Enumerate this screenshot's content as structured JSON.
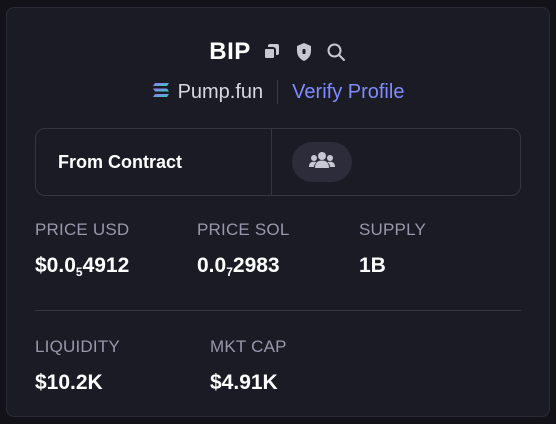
{
  "token": {
    "symbol": "BIP",
    "platform": "Pump.fun",
    "verify_label": "Verify Profile"
  },
  "contract": {
    "label": "From Contract"
  },
  "stats": {
    "price_usd": {
      "label": "PRICE USD",
      "prefix": "$0.0",
      "sub": "5",
      "suffix": "4912"
    },
    "price_sol": {
      "label": "PRICE SOL",
      "prefix": "0.0",
      "sub": "7",
      "suffix": "2983"
    },
    "supply": {
      "label": "SUPPLY",
      "value": "1B"
    },
    "liquidity": {
      "label": "LIQUIDITY",
      "value": "$10.2K"
    },
    "mkt_cap": {
      "label": "MKT CAP",
      "value": "$4.91K"
    }
  },
  "icons": {
    "copy": "copy-icon",
    "shield": "shield-icon",
    "search": "search-icon",
    "platform": "pumpfun-logo-icon",
    "holders": "users-icon"
  },
  "colors": {
    "accent": "#7f8cff",
    "label": "#9898ac",
    "background": "#1b1b25"
  }
}
